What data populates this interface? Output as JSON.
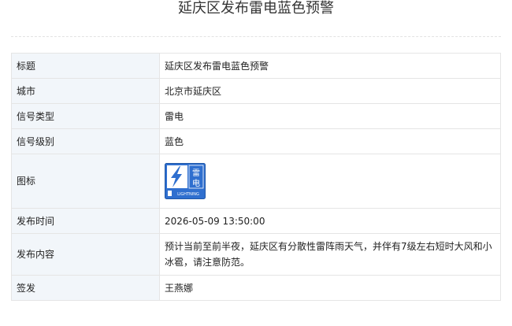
{
  "page": {
    "title": "延庆区发布雷电蓝色预警"
  },
  "rows": [
    {
      "label": "标题",
      "value": "延庆区发布雷电蓝色预警"
    },
    {
      "label": "城市",
      "value": "北京市延庆区"
    },
    {
      "label": "信号类型",
      "value": "雷电"
    },
    {
      "label": "信号级别",
      "value": "蓝色"
    },
    {
      "label": "图标",
      "value": ""
    },
    {
      "label": "发布时间",
      "value": "2026-05-09 13:50:00"
    },
    {
      "label": "发布内容",
      "value": "预计当前至前半夜，延庆区有分散性雷阵雨天气，并伴有7级左右短时大风和小冰雹，请注意防范。"
    },
    {
      "label": "签发",
      "value": "王燕娜"
    }
  ],
  "icon": {
    "name": "lightning-warning-icon",
    "cn_text": "雷电",
    "en_text": "LIGHTNING",
    "color": "#2f6fcf"
  }
}
